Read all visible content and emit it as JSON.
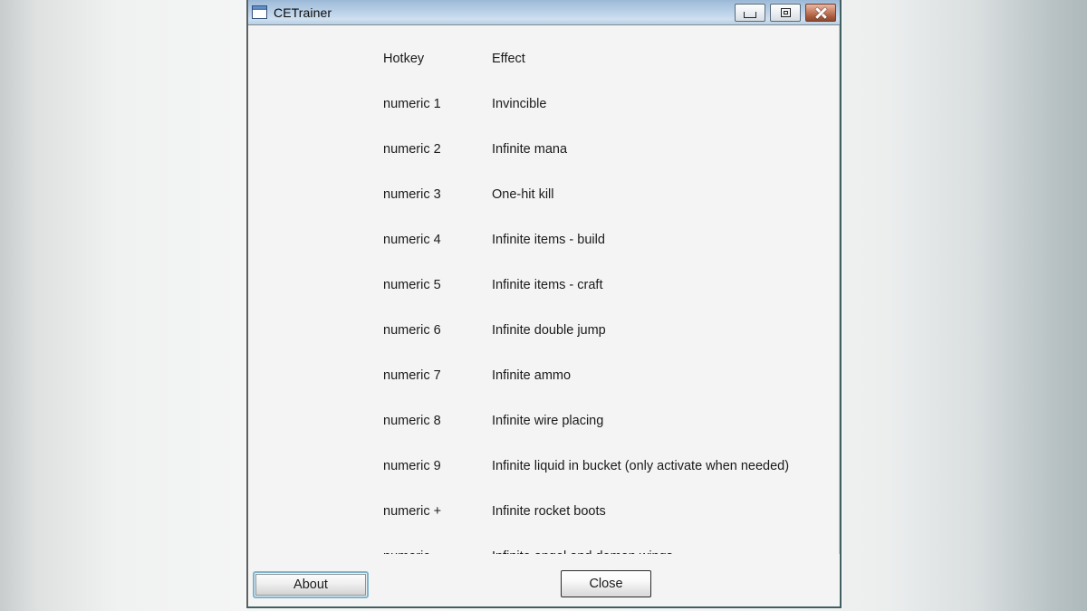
{
  "window": {
    "title": "CETrainer",
    "icon": "window-icon",
    "titlebar_buttons": [
      {
        "name": "minimize-button",
        "glyph": "minimize-icon",
        "label": "Minimize"
      },
      {
        "name": "maximize-button",
        "glyph": "maximize-icon",
        "label": "Maximize"
      },
      {
        "name": "close-window-button",
        "glyph": "close-icon",
        "label": "Close"
      }
    ]
  },
  "table": {
    "headers": {
      "hotkey": "Hotkey",
      "effect": "Effect"
    },
    "rows": [
      {
        "hotkey": "numeric 1",
        "effect": "Invincible"
      },
      {
        "hotkey": "numeric 2",
        "effect": "Infinite mana"
      },
      {
        "hotkey": "numeric 3",
        "effect": "One-hit kill"
      },
      {
        "hotkey": "numeric 4",
        "effect": "Infinite items - build"
      },
      {
        "hotkey": "numeric 5",
        "effect": "Infinite items - craft"
      },
      {
        "hotkey": "numeric 6",
        "effect": "Infinite double jump"
      },
      {
        "hotkey": "numeric 7",
        "effect": "Infinite ammo"
      },
      {
        "hotkey": "numeric 8",
        "effect": "Infinite wire placing"
      },
      {
        "hotkey": "numeric 9",
        "effect": "Infinite liquid in bucket (only activate when needed)"
      },
      {
        "hotkey": "numeric +",
        "effect": "Infinite rocket boots"
      },
      {
        "hotkey": "numeric -",
        "effect": "Infinite angel and demon wings"
      }
    ]
  },
  "footer": {
    "about_label": "About",
    "close_label": "Close"
  },
  "colors": {
    "titlebar_start": "#9bb8d6",
    "titlebar_end": "#b9cfe6",
    "close_button_red": "#a85a3c",
    "focus_ring": "#7fb4cd",
    "content_bg": "#f4f4f4"
  }
}
